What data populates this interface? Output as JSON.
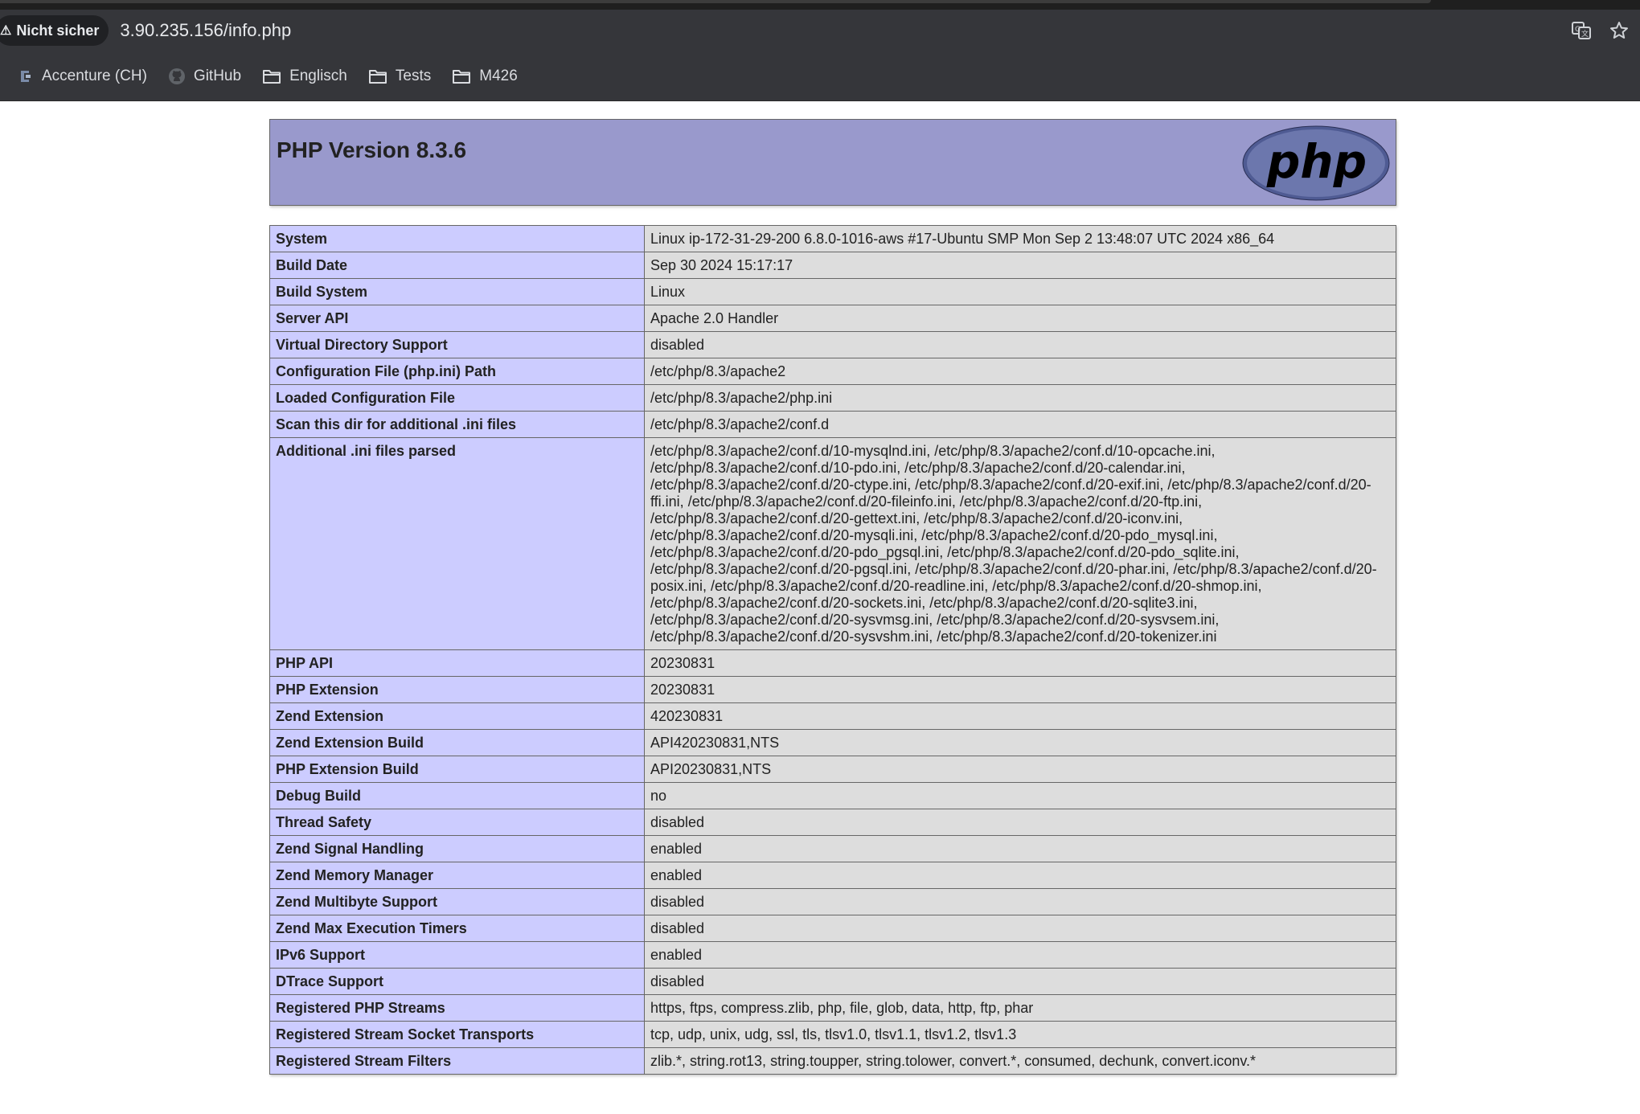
{
  "browser": {
    "security_label": "Nicht sicher",
    "url": "3.90.235.156/info.php",
    "bookmarks": [
      {
        "label": "Accenture (CH)",
        "icon": "accenture-favicon"
      },
      {
        "label": "GitHub",
        "icon": "github-icon"
      },
      {
        "label": "Englisch",
        "icon": "folder-icon"
      },
      {
        "label": "Tests",
        "icon": "folder-icon"
      },
      {
        "label": "M426",
        "icon": "folder-icon"
      }
    ]
  },
  "page": {
    "title": "PHP Version 8.3.6",
    "logo_text": "php",
    "rows": [
      {
        "key": "System",
        "value": "Linux ip-172-31-29-200 6.8.0-1016-aws #17-Ubuntu SMP Mon Sep 2 13:48:07 UTC 2024 x86_64"
      },
      {
        "key": "Build Date",
        "value": "Sep 30 2024 15:17:17"
      },
      {
        "key": "Build System",
        "value": "Linux"
      },
      {
        "key": "Server API",
        "value": "Apache 2.0 Handler"
      },
      {
        "key": "Virtual Directory Support",
        "value": "disabled"
      },
      {
        "key": "Configuration File (php.ini) Path",
        "value": "/etc/php/8.3/apache2"
      },
      {
        "key": "Loaded Configuration File",
        "value": "/etc/php/8.3/apache2/php.ini"
      },
      {
        "key": "Scan this dir for additional .ini files",
        "value": "/etc/php/8.3/apache2/conf.d"
      },
      {
        "key": "Additional .ini files parsed",
        "value": "/etc/php/8.3/apache2/conf.d/10-mysqlnd.ini, /etc/php/8.3/apache2/conf.d/10-opcache.ini, /etc/php/8.3/apache2/conf.d/10-pdo.ini, /etc/php/8.3/apache2/conf.d/20-calendar.ini, /etc/php/8.3/apache2/conf.d/20-ctype.ini, /etc/php/8.3/apache2/conf.d/20-exif.ini, /etc/php/8.3/apache2/conf.d/20-ffi.ini, /etc/php/8.3/apache2/conf.d/20-fileinfo.ini, /etc/php/8.3/apache2/conf.d/20-ftp.ini, /etc/php/8.3/apache2/conf.d/20-gettext.ini, /etc/php/8.3/apache2/conf.d/20-iconv.ini, /etc/php/8.3/apache2/conf.d/20-mysqli.ini, /etc/php/8.3/apache2/conf.d/20-pdo_mysql.ini, /etc/php/8.3/apache2/conf.d/20-pdo_pgsql.ini, /etc/php/8.3/apache2/conf.d/20-pdo_sqlite.ini, /etc/php/8.3/apache2/conf.d/20-pgsql.ini, /etc/php/8.3/apache2/conf.d/20-phar.ini, /etc/php/8.3/apache2/conf.d/20-posix.ini, /etc/php/8.3/apache2/conf.d/20-readline.ini, /etc/php/8.3/apache2/conf.d/20-shmop.ini, /etc/php/8.3/apache2/conf.d/20-sockets.ini, /etc/php/8.3/apache2/conf.d/20-sqlite3.ini, /etc/php/8.3/apache2/conf.d/20-sysvmsg.ini, /etc/php/8.3/apache2/conf.d/20-sysvsem.ini, /etc/php/8.3/apache2/conf.d/20-sysvshm.ini, /etc/php/8.3/apache2/conf.d/20-tokenizer.ini"
      },
      {
        "key": "PHP API",
        "value": "20230831"
      },
      {
        "key": "PHP Extension",
        "value": "20230831"
      },
      {
        "key": "Zend Extension",
        "value": "420230831"
      },
      {
        "key": "Zend Extension Build",
        "value": "API420230831,NTS"
      },
      {
        "key": "PHP Extension Build",
        "value": "API20230831,NTS"
      },
      {
        "key": "Debug Build",
        "value": "no"
      },
      {
        "key": "Thread Safety",
        "value": "disabled"
      },
      {
        "key": "Zend Signal Handling",
        "value": "enabled"
      },
      {
        "key": "Zend Memory Manager",
        "value": "enabled"
      },
      {
        "key": "Zend Multibyte Support",
        "value": "disabled"
      },
      {
        "key": "Zend Max Execution Timers",
        "value": "disabled"
      },
      {
        "key": "IPv6 Support",
        "value": "enabled"
      },
      {
        "key": "DTrace Support",
        "value": "disabled"
      },
      {
        "key": "Registered PHP Streams",
        "value": "https, ftps, compress.zlib, php, file, glob, data, http, ftp, phar"
      },
      {
        "key": "Registered Stream Socket Transports",
        "value": "tcp, udp, unix, udg, ssl, tls, tlsv1.0, tlsv1.1, tlsv1.2, tlsv1.3"
      },
      {
        "key": "Registered Stream Filters",
        "value": "zlib.*, string.rot13, string.toupper, string.tolower, convert.*, consumed, dechunk, convert.iconv.*"
      }
    ]
  },
  "colors": {
    "header_bg": "#9999cc",
    "key_cell_bg": "#ccccff",
    "value_cell_bg": "#dddddd",
    "chrome_bg": "#35363a"
  }
}
